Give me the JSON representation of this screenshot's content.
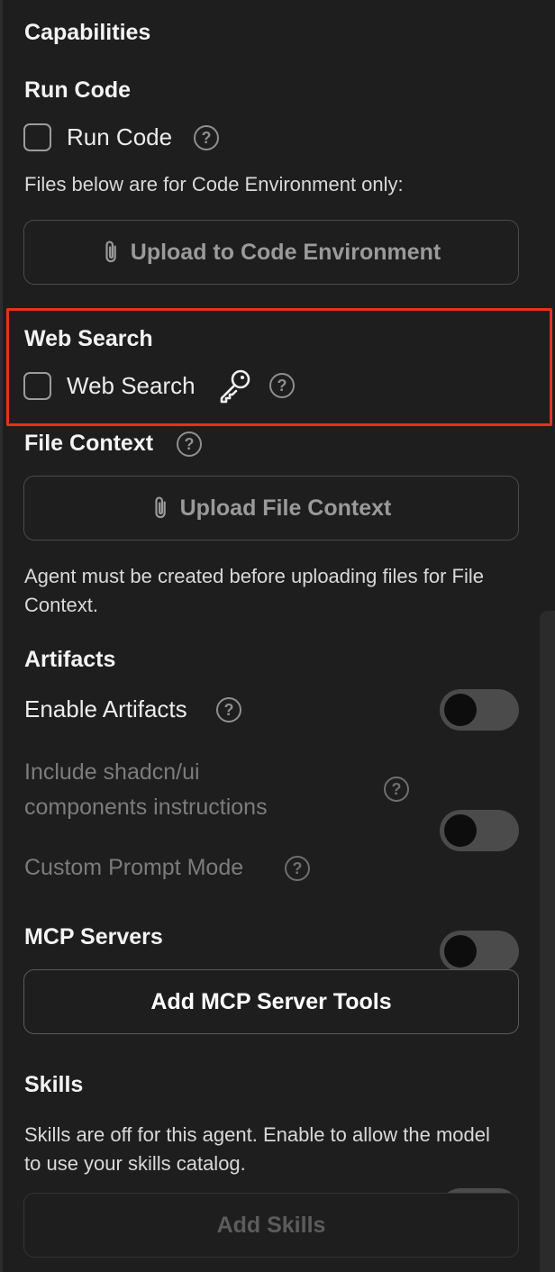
{
  "capabilities": {
    "title": "Capabilities"
  },
  "run_code": {
    "title": "Run Code",
    "checkbox_label": "Run Code",
    "checked": false,
    "note": "Files below are for Code Environment only:",
    "upload_label": "Upload to Code Environment"
  },
  "web_search": {
    "title": "Web Search",
    "checkbox_label": "Web Search",
    "checked": false,
    "highlight_color": "#e8321c"
  },
  "file_context": {
    "title": "File Context",
    "upload_label": "Upload File Context",
    "note": "Agent must be created before uploading files for File Context."
  },
  "artifacts": {
    "title": "Artifacts",
    "enable_label": "Enable Artifacts",
    "shadcn_label": "Include shadcn/ui components instructions",
    "custom_prompt_label": "Custom Prompt Mode",
    "enable_on": false,
    "shadcn_on": false,
    "custom_prompt_on": false
  },
  "mcp": {
    "title": "MCP Servers",
    "add_label": "Add MCP Server Tools"
  },
  "skills": {
    "title": "Skills",
    "enabled": false,
    "note": "Skills are off for this agent. Enable to allow the model to use your skills catalog.",
    "add_label": "Add Skills"
  },
  "help_glyph": "?",
  "icons": {
    "help": "question-circle-icon",
    "clip": "paperclip-icon",
    "key": "key-icon"
  }
}
